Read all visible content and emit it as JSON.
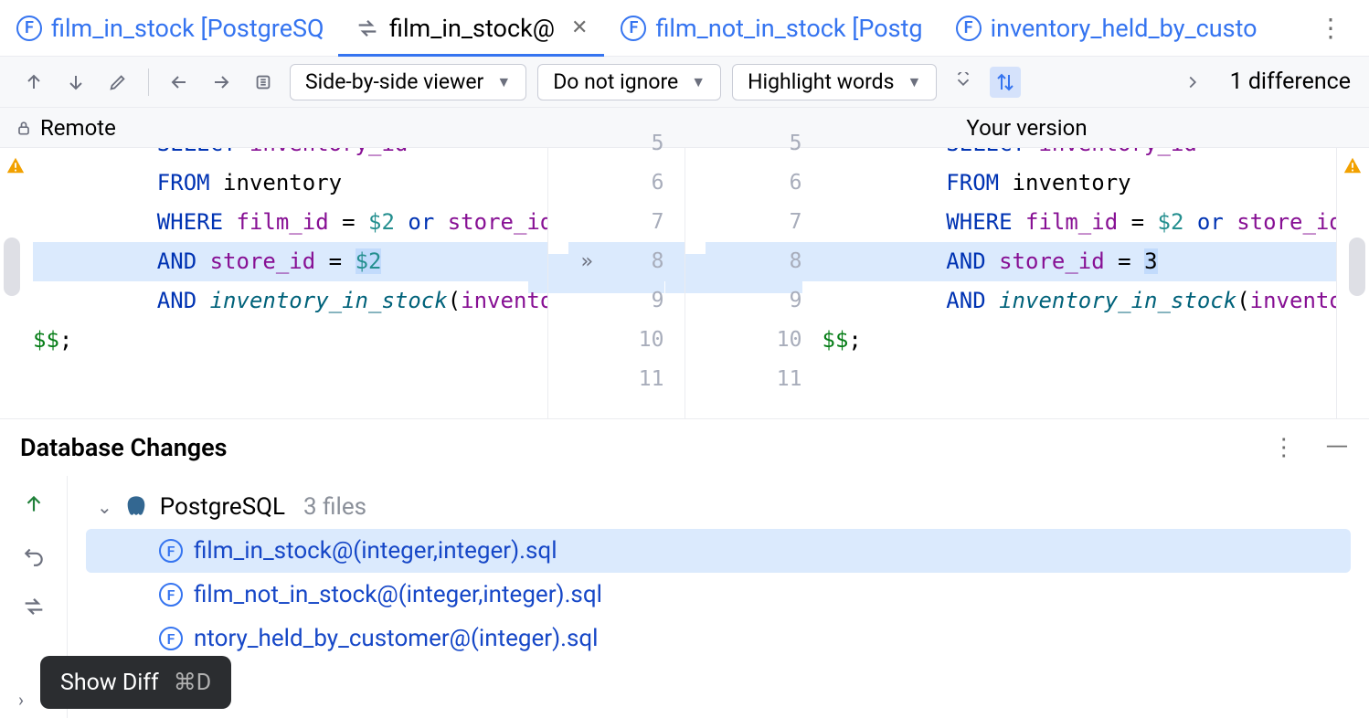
{
  "tabs": [
    {
      "label": "film_in_stock [PostgreSQ"
    },
    {
      "label": "film_in_stock@",
      "active": true
    },
    {
      "label": "film_not_in_stock [Postg"
    },
    {
      "label": "inventory_held_by_custo"
    }
  ],
  "toolbar": {
    "viewer_mode": "Side-by-side viewer",
    "ignore_mode": "Do not ignore",
    "highlight_mode": "Highlight words",
    "diff_summary": "1 difference"
  },
  "panels": {
    "left_label": "Remote",
    "right_label": "Your version"
  },
  "code": {
    "left": {
      "lines": [
        {
          "n": 5,
          "tokens": [
            [
              "    ",
              "pl"
            ],
            [
              "SELECT",
              "kw"
            ],
            [
              " ",
              "pl"
            ],
            [
              "inventory_id",
              "ident"
            ]
          ],
          "cut": true
        },
        {
          "n": 6,
          "tokens": [
            [
              "    ",
              "pl"
            ],
            [
              "FROM",
              "kw"
            ],
            [
              " inventory",
              "pl"
            ]
          ]
        },
        {
          "n": 7,
          "tokens": [
            [
              "    ",
              "pl"
            ],
            [
              "WHERE",
              "kw"
            ],
            [
              " ",
              "pl"
            ],
            [
              "film_id",
              "ident"
            ],
            [
              " = ",
              "pl"
            ],
            [
              "$2",
              "param"
            ],
            [
              " ",
              "pl"
            ],
            [
              "or",
              "kw"
            ],
            [
              " ",
              "pl"
            ],
            [
              "store_id",
              "ident"
            ]
          ]
        },
        {
          "n": 8,
          "diff": true,
          "tokens": [
            [
              "    ",
              "pl"
            ],
            [
              "AND",
              "kw"
            ],
            [
              " ",
              "pl"
            ],
            [
              "store_id",
              "ident"
            ],
            [
              " = ",
              "pl"
            ],
            [
              "$2",
              "param hl"
            ]
          ]
        },
        {
          "n": 9,
          "tokens": [
            [
              "    ",
              "pl"
            ],
            [
              "AND",
              "kw"
            ],
            [
              " ",
              "pl"
            ],
            [
              "inventory_in_stock",
              "func"
            ],
            [
              "(",
              "pl"
            ],
            [
              "inventor",
              "ident"
            ]
          ]
        },
        {
          "n": 10,
          "tokens": [
            [
              "$$",
              "dd"
            ],
            [
              ";",
              "pl"
            ]
          ],
          "flush": true
        },
        {
          "n": 11,
          "tokens": [
            [
              "",
              "pl"
            ]
          ]
        }
      ]
    },
    "right": {
      "lines": [
        {
          "n": 5,
          "tokens": [
            [
              "    ",
              "pl"
            ],
            [
              "SELECT",
              "kw"
            ],
            [
              " ",
              "pl"
            ],
            [
              "inventory_id",
              "ident"
            ]
          ],
          "cut": true
        },
        {
          "n": 6,
          "tokens": [
            [
              "    ",
              "pl"
            ],
            [
              "FROM",
              "kw"
            ],
            [
              " inventory",
              "pl"
            ]
          ]
        },
        {
          "n": 7,
          "tokens": [
            [
              "    ",
              "pl"
            ],
            [
              "WHERE",
              "kw"
            ],
            [
              " ",
              "pl"
            ],
            [
              "film_id",
              "ident"
            ],
            [
              " = ",
              "pl"
            ],
            [
              "$2",
              "param"
            ],
            [
              " ",
              "pl"
            ],
            [
              "or",
              "kw"
            ],
            [
              " ",
              "pl"
            ],
            [
              "store_id",
              "ident"
            ],
            [
              " =",
              "pl"
            ]
          ]
        },
        {
          "n": 8,
          "diff": true,
          "tokens": [
            [
              "    ",
              "pl"
            ],
            [
              "AND",
              "kw"
            ],
            [
              " ",
              "pl"
            ],
            [
              "store_id",
              "ident"
            ],
            [
              " = ",
              "pl"
            ],
            [
              "3",
              "pl hl"
            ]
          ]
        },
        {
          "n": 9,
          "tokens": [
            [
              "    ",
              "pl"
            ],
            [
              "AND",
              "kw"
            ],
            [
              " ",
              "pl"
            ],
            [
              "inventory_in_stock",
              "func"
            ],
            [
              "(",
              "pl"
            ],
            [
              "inventory_",
              "ident"
            ]
          ]
        },
        {
          "n": 10,
          "tokens": [
            [
              "$$",
              "dd"
            ],
            [
              ";",
              "pl"
            ]
          ],
          "flush": true
        },
        {
          "n": 11,
          "tokens": [
            [
              "",
              "pl"
            ]
          ]
        }
      ]
    }
  },
  "changes_panel": {
    "title": "Database Changes",
    "group_label": "PostgreSQL",
    "group_count": "3 files",
    "files": [
      {
        "name": "film_in_stock@(integer,integer).sql",
        "selected": true
      },
      {
        "name": "film_not_in_stock@(integer,integer).sql"
      },
      {
        "name": "ntory_held_by_customer@(integer).sql"
      }
    ]
  },
  "tooltip": {
    "label": "Show Diff",
    "shortcut": "⌘D"
  }
}
